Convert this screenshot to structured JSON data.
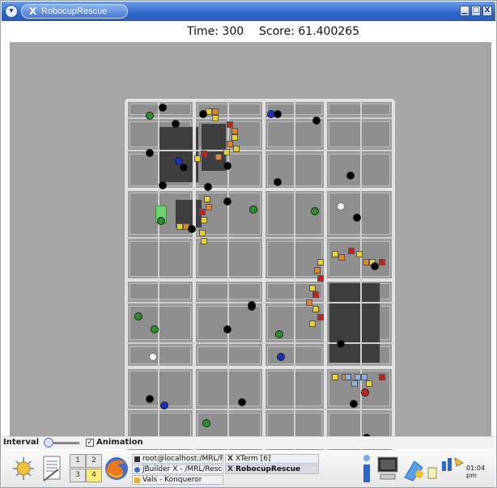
{
  "window": {
    "title": "RobocupRescue",
    "menu_glyph": "▾",
    "close_glyph": "X",
    "btn_minimize": "▁",
    "btn_maximize": "□",
    "btn_close": "X"
  },
  "status": {
    "time_text": "Time: 300",
    "score_text": "Score: 61.400265"
  },
  "controls": {
    "interval_label": "Interval",
    "animation_label": "Animation",
    "animation_checked_glyph": "✓"
  },
  "taskbar": {
    "pager": [
      "1",
      "2",
      "3",
      "4"
    ],
    "tasks": [
      {
        "label": "root@localhost:/MRL/Rescue",
        "icon": "terminal-icon"
      },
      {
        "label": "XTerm [6]",
        "icon": "x-icon"
      },
      {
        "label": "jBuilder X - /MRL/Rescue S",
        "icon": "jbuilder-icon"
      },
      {
        "label": "RobocupRescue",
        "icon": "x-icon"
      },
      {
        "label": "Vals - Konqueror",
        "icon": "konqueror-icon"
      }
    ],
    "clock": "01:04 pm"
  },
  "colors": {
    "titlebar": "#2f66c9",
    "map_background": "#a5a5a5",
    "road": "#e2e2e2",
    "fire_yellow": "#e8d229",
    "fire_orange": "#e0852c",
    "fire_red": "#c81e1e",
    "burned": "#3e3e3e",
    "agent_black": "#000000",
    "agent_blue": "#1c2fc2",
    "agent_green": "#2f8f2f",
    "refuge_blue": "#8fb1e6"
  }
}
